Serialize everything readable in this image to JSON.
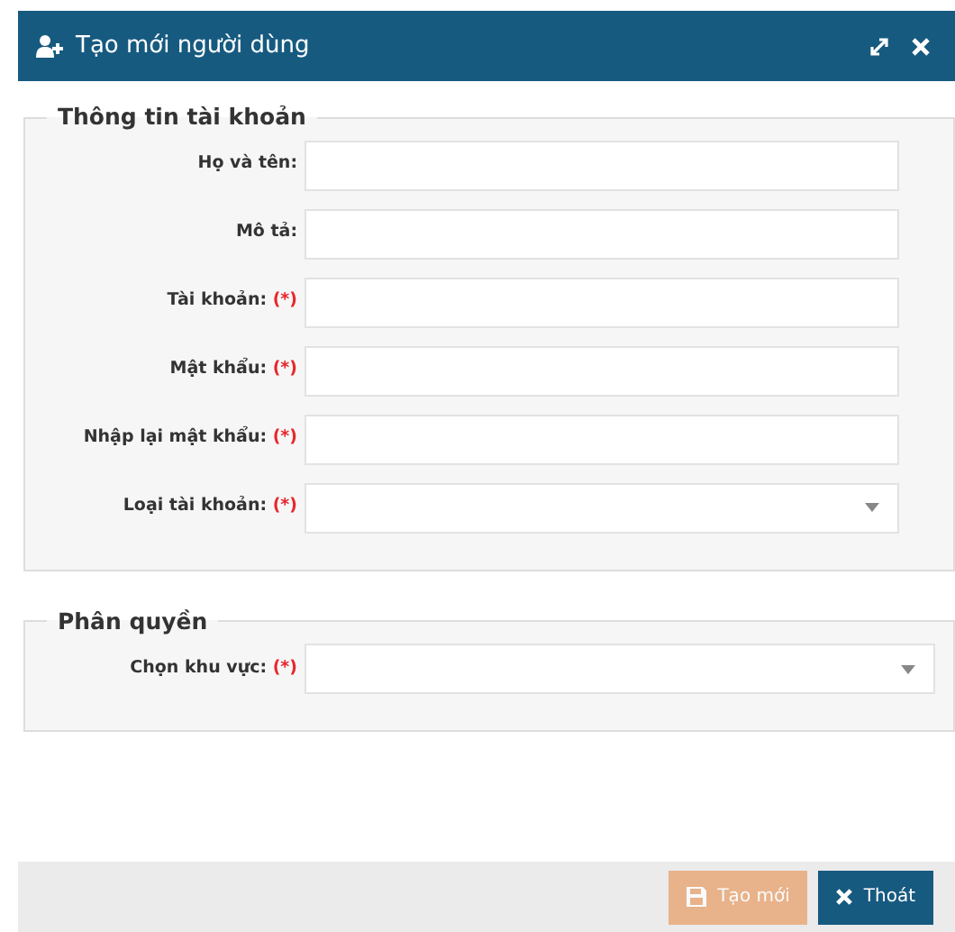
{
  "window": {
    "title": "Tạo mới người dùng"
  },
  "sections": [
    {
      "legend": "Thông tin tài khoản",
      "fields": [
        {
          "label": "Họ và tên:",
          "kind": "text"
        },
        {
          "label": "Mô tả:",
          "kind": "text"
        },
        {
          "label": "Tài khoản:",
          "kind": "text",
          "required_mark": "(*)"
        },
        {
          "label": "Mật khẩu:",
          "kind": "text",
          "required_mark": "(*)"
        },
        {
          "label": "Nhập lại mật khẩu:",
          "kind": "text",
          "required_mark": "(*)"
        },
        {
          "label": "Loại tài khoản:",
          "kind": "select",
          "required_mark": "(*)"
        }
      ]
    },
    {
      "legend": "Phân quyền",
      "fields": [
        {
          "label": "Chọn khu vực:",
          "kind": "select",
          "required_mark": "(*)"
        }
      ]
    }
  ],
  "buttons": [
    {
      "label": "Tạo mới",
      "kind": "save",
      "disabled": true
    },
    {
      "label": "Thoát",
      "kind": "close",
      "disabled": false
    }
  ]
}
